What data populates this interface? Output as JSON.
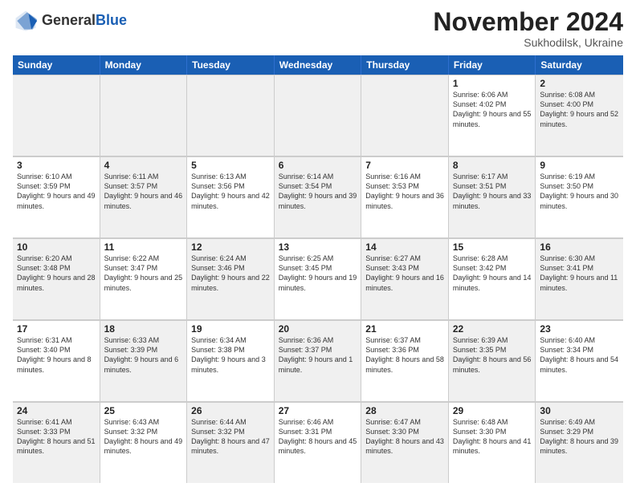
{
  "header": {
    "logo_general": "General",
    "logo_blue": "Blue",
    "month_title": "November 2024",
    "location": "Sukhodilsk, Ukraine"
  },
  "days_of_week": [
    "Sunday",
    "Monday",
    "Tuesday",
    "Wednesday",
    "Thursday",
    "Friday",
    "Saturday"
  ],
  "weeks": [
    [
      {
        "day": "",
        "info": "",
        "shaded": true
      },
      {
        "day": "",
        "info": "",
        "shaded": true
      },
      {
        "day": "",
        "info": "",
        "shaded": true
      },
      {
        "day": "",
        "info": "",
        "shaded": true
      },
      {
        "day": "",
        "info": "",
        "shaded": true
      },
      {
        "day": "1",
        "info": "Sunrise: 6:06 AM\nSunset: 4:02 PM\nDaylight: 9 hours and 55 minutes.",
        "shaded": false
      },
      {
        "day": "2",
        "info": "Sunrise: 6:08 AM\nSunset: 4:00 PM\nDaylight: 9 hours and 52 minutes.",
        "shaded": true
      }
    ],
    [
      {
        "day": "3",
        "info": "Sunrise: 6:10 AM\nSunset: 3:59 PM\nDaylight: 9 hours and 49 minutes.",
        "shaded": false
      },
      {
        "day": "4",
        "info": "Sunrise: 6:11 AM\nSunset: 3:57 PM\nDaylight: 9 hours and 46 minutes.",
        "shaded": true
      },
      {
        "day": "5",
        "info": "Sunrise: 6:13 AM\nSunset: 3:56 PM\nDaylight: 9 hours and 42 minutes.",
        "shaded": false
      },
      {
        "day": "6",
        "info": "Sunrise: 6:14 AM\nSunset: 3:54 PM\nDaylight: 9 hours and 39 minutes.",
        "shaded": true
      },
      {
        "day": "7",
        "info": "Sunrise: 6:16 AM\nSunset: 3:53 PM\nDaylight: 9 hours and 36 minutes.",
        "shaded": false
      },
      {
        "day": "8",
        "info": "Sunrise: 6:17 AM\nSunset: 3:51 PM\nDaylight: 9 hours and 33 minutes.",
        "shaded": true
      },
      {
        "day": "9",
        "info": "Sunrise: 6:19 AM\nSunset: 3:50 PM\nDaylight: 9 hours and 30 minutes.",
        "shaded": false
      }
    ],
    [
      {
        "day": "10",
        "info": "Sunrise: 6:20 AM\nSunset: 3:48 PM\nDaylight: 9 hours and 28 minutes.",
        "shaded": true
      },
      {
        "day": "11",
        "info": "Sunrise: 6:22 AM\nSunset: 3:47 PM\nDaylight: 9 hours and 25 minutes.",
        "shaded": false
      },
      {
        "day": "12",
        "info": "Sunrise: 6:24 AM\nSunset: 3:46 PM\nDaylight: 9 hours and 22 minutes.",
        "shaded": true
      },
      {
        "day": "13",
        "info": "Sunrise: 6:25 AM\nSunset: 3:45 PM\nDaylight: 9 hours and 19 minutes.",
        "shaded": false
      },
      {
        "day": "14",
        "info": "Sunrise: 6:27 AM\nSunset: 3:43 PM\nDaylight: 9 hours and 16 minutes.",
        "shaded": true
      },
      {
        "day": "15",
        "info": "Sunrise: 6:28 AM\nSunset: 3:42 PM\nDaylight: 9 hours and 14 minutes.",
        "shaded": false
      },
      {
        "day": "16",
        "info": "Sunrise: 6:30 AM\nSunset: 3:41 PM\nDaylight: 9 hours and 11 minutes.",
        "shaded": true
      }
    ],
    [
      {
        "day": "17",
        "info": "Sunrise: 6:31 AM\nSunset: 3:40 PM\nDaylight: 9 hours and 8 minutes.",
        "shaded": false
      },
      {
        "day": "18",
        "info": "Sunrise: 6:33 AM\nSunset: 3:39 PM\nDaylight: 9 hours and 6 minutes.",
        "shaded": true
      },
      {
        "day": "19",
        "info": "Sunrise: 6:34 AM\nSunset: 3:38 PM\nDaylight: 9 hours and 3 minutes.",
        "shaded": false
      },
      {
        "day": "20",
        "info": "Sunrise: 6:36 AM\nSunset: 3:37 PM\nDaylight: 9 hours and 1 minute.",
        "shaded": true
      },
      {
        "day": "21",
        "info": "Sunrise: 6:37 AM\nSunset: 3:36 PM\nDaylight: 8 hours and 58 minutes.",
        "shaded": false
      },
      {
        "day": "22",
        "info": "Sunrise: 6:39 AM\nSunset: 3:35 PM\nDaylight: 8 hours and 56 minutes.",
        "shaded": true
      },
      {
        "day": "23",
        "info": "Sunrise: 6:40 AM\nSunset: 3:34 PM\nDaylight: 8 hours and 54 minutes.",
        "shaded": false
      }
    ],
    [
      {
        "day": "24",
        "info": "Sunrise: 6:41 AM\nSunset: 3:33 PM\nDaylight: 8 hours and 51 minutes.",
        "shaded": true
      },
      {
        "day": "25",
        "info": "Sunrise: 6:43 AM\nSunset: 3:32 PM\nDaylight: 8 hours and 49 minutes.",
        "shaded": false
      },
      {
        "day": "26",
        "info": "Sunrise: 6:44 AM\nSunset: 3:32 PM\nDaylight: 8 hours and 47 minutes.",
        "shaded": true
      },
      {
        "day": "27",
        "info": "Sunrise: 6:46 AM\nSunset: 3:31 PM\nDaylight: 8 hours and 45 minutes.",
        "shaded": false
      },
      {
        "day": "28",
        "info": "Sunrise: 6:47 AM\nSunset: 3:30 PM\nDaylight: 8 hours and 43 minutes.",
        "shaded": true
      },
      {
        "day": "29",
        "info": "Sunrise: 6:48 AM\nSunset: 3:30 PM\nDaylight: 8 hours and 41 minutes.",
        "shaded": false
      },
      {
        "day": "30",
        "info": "Sunrise: 6:49 AM\nSunset: 3:29 PM\nDaylight: 8 hours and 39 minutes.",
        "shaded": true
      }
    ]
  ]
}
